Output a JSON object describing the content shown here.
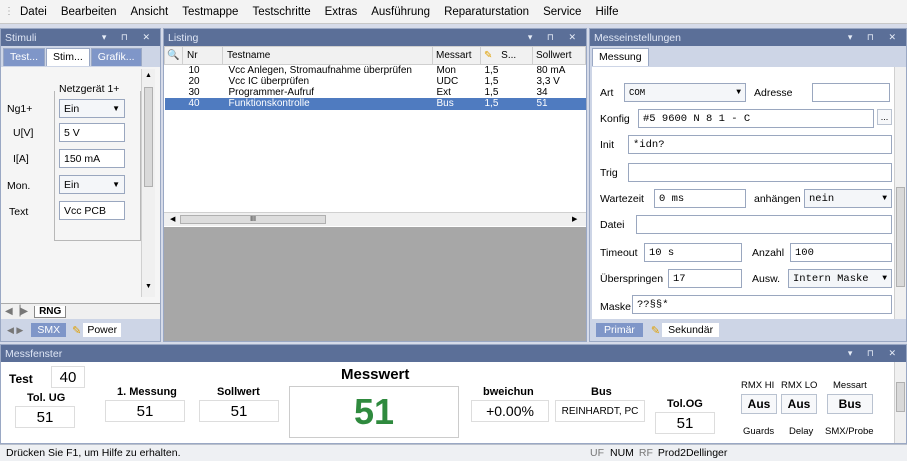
{
  "menu": [
    "Datei",
    "Bearbeiten",
    "Ansicht",
    "Testmappe",
    "Testschritte",
    "Extras",
    "Ausführung",
    "Reparaturstation",
    "Service",
    "Hilfe"
  ],
  "stimuli": {
    "title": "Stimuli",
    "tabs": [
      "Test...",
      "Stim...",
      "Grafik..."
    ],
    "group": "Netzgerät 1+",
    "rows": [
      {
        "label": "Ng1+",
        "value": "Ein",
        "type": "combo"
      },
      {
        "label": "U[V]",
        "value": "5 V",
        "type": "field"
      },
      {
        "label": "I[A]",
        "value": "150 mA",
        "type": "field"
      },
      {
        "label": "Mon.",
        "value": "Ein",
        "type": "combo"
      },
      {
        "label": "Text",
        "value": "Vcc PCB",
        "type": "field"
      }
    ],
    "sheet_tab": "RNG",
    "bottom_tabs": [
      "SMX",
      "Power"
    ]
  },
  "listing": {
    "title": "Listing",
    "columns": [
      "Nr",
      "Testname",
      "Messart",
      "S...",
      "Sollwert"
    ],
    "rows": [
      {
        "nr": "10",
        "name": "Vcc Anlegen, Stromaufnahme überprüfen",
        "art": "Mon",
        "s": "1,5",
        "soll": "80 mA"
      },
      {
        "nr": "20",
        "name": "Vcc IC überprüfen",
        "art": "UDC",
        "s": "1,5",
        "soll": "3,3 V"
      },
      {
        "nr": "30",
        "name": "Programmer-Aufruf",
        "art": "Ext",
        "s": "1,5",
        "soll": "34"
      },
      {
        "nr": "40",
        "name": "Funktionskontrolle",
        "art": "Bus",
        "s": "1,5",
        "soll": "51"
      }
    ],
    "scroll_glyph": "III"
  },
  "mess": {
    "title": "Messeinstellungen",
    "tab": "Messung",
    "art_label": "Art",
    "art_value": "COM",
    "adresse_label": "Adresse",
    "adresse_value": "",
    "konfig_label": "Konfig",
    "konfig_value": "#5 9600 N 8 1 - C",
    "konfig_btn": "...",
    "init_label": "Init",
    "init_value": "*idn?",
    "trig_label": "Trig",
    "trig_value": "",
    "wartezeit_label": "Wartezeit",
    "wartezeit_value": "0 ms",
    "anhaengen_label": "anhängen",
    "anhaengen_value": "nein",
    "datei_label": "Datei",
    "datei_value": "",
    "timeout_label": "Timeout",
    "timeout_value": "10 s",
    "anzahl_label": "Anzahl",
    "anzahl_value": "100",
    "ueber_label": "Überspringen",
    "ueber_value": "17",
    "ausw_label": "Ausw.",
    "ausw_value": "Intern Maske",
    "maske_label": "Maske",
    "maske_value": "??§§*",
    "bottom_tabs": [
      "Primär",
      "Sekundär"
    ]
  },
  "messfenster": {
    "title": "Messfenster",
    "test_label": "Test",
    "test_value": "40",
    "tolug_label": "Tol. UG",
    "tolug_value": "51",
    "m1_label": "1. Messung",
    "m1_value": "51",
    "soll_label": "Sollwert",
    "soll_value": "51",
    "mw_label": "Messwert",
    "mw_value": "51",
    "abw_label": "bweichun",
    "abw_value": "+0.00%",
    "bus_label": "Bus",
    "bus_value": "REINHARDT, PC",
    "tolog_label": "Tol.OG",
    "tolog_value": "51",
    "rmxhi_label": "RMX HI",
    "rmxhi_value": "Aus",
    "rmxlo_label": "RMX LO",
    "rmxlo_value": "Aus",
    "messart_label": "Messart",
    "messart_value": "Bus",
    "guards_label": "Guards",
    "delay_label": "Delay",
    "smx_label": "SMX/Probe"
  },
  "status": {
    "text": "Drücken Sie F1, um Hilfe zu erhalten.",
    "uf": "UF",
    "num": "NUM",
    "rf": "RF",
    "prod": "Prod2Dellinger"
  },
  "colors": {
    "title_bar": "#5b6f98",
    "selection": "#4f7bc0",
    "messwert": "#2f8a3e"
  }
}
